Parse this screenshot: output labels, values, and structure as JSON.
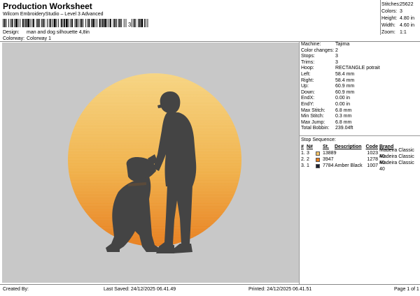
{
  "header": {
    "title": "Production Worksheet",
    "subtitle": "Wilcom EmbroideryStudio – Level 3 Advanced",
    "barcode_text": "3"
  },
  "meta": {
    "design_label": "Design:",
    "design_value": "man and dog silhouette 4,8in",
    "colorway_label": "Colorway:",
    "colorway_value": "Colorway 1"
  },
  "stats": [
    {
      "label": "Stitches:",
      "value": "25622"
    },
    {
      "label": "Colors:",
      "value": "3"
    },
    {
      "label": "Height:",
      "value": "4.80 in"
    },
    {
      "label": "Width:",
      "value": "4.60 in"
    },
    {
      "label": "Zoom:",
      "value": "1:1"
    }
  ],
  "machine_info": [
    {
      "label": "Machine:",
      "value": "Tajima"
    },
    {
      "label": "Color changes:",
      "value": "2"
    },
    {
      "label": "Stops:",
      "value": "3"
    },
    {
      "label": "Trims:",
      "value": "3"
    },
    {
      "label": "Hoop:",
      "value": "RECTANGLE potrait"
    },
    {
      "label": "Left:",
      "value": "58.4 mm"
    },
    {
      "label": "Right:",
      "value": "58.4 mm"
    },
    {
      "label": "Up:",
      "value": "60.9 mm"
    },
    {
      "label": "Down:",
      "value": "60.9 mm"
    },
    {
      "label": "EndX:",
      "value": "0.00 in"
    },
    {
      "label": "EndY:",
      "value": "0.00 in"
    },
    {
      "label": "Max Stitch:",
      "value": "6.8 mm"
    },
    {
      "label": "Min Stitch:",
      "value": "0.3 mm"
    },
    {
      "label": "Max Jump:",
      "value": "6.8 mm"
    },
    {
      "label": "Total Bobbin:",
      "value": "239.04ft"
    }
  ],
  "stop_sequence": {
    "title": "Stop Sequence:",
    "headers": {
      "num": "#",
      "n": "N#",
      "st": "St.",
      "desc": "Description",
      "code": "Code",
      "brand": "Brand"
    },
    "rows": [
      {
        "num": "1.",
        "n": "3",
        "color": "#f5c56a",
        "st": "13889",
        "desc": "",
        "code": "1023",
        "brand": "Madeira Classic 40"
      },
      {
        "num": "2.",
        "n": "2",
        "color": "#e87a1a",
        "st": "3947",
        "desc": "",
        "code": "1278",
        "brand": "Madeira Classic 40"
      },
      {
        "num": "3.",
        "n": "1",
        "color": "#1e2230",
        "st": "7784",
        "desc": "Amber Black",
        "code": "1007",
        "brand": "Madeira Classic 40"
      }
    ]
  },
  "footer": {
    "created": "Created By:",
    "saved": "Last Saved: 24/12/2025 06.41.49",
    "printed": "Printed: 24/12/2025 06.41.51",
    "page": "Page 1 of 1"
  },
  "colors": {
    "canvas_bg": "#c8c8c8",
    "sun_top": "#f6d37e",
    "sun_bottom": "#e77b18",
    "silhouette": "#444444"
  }
}
